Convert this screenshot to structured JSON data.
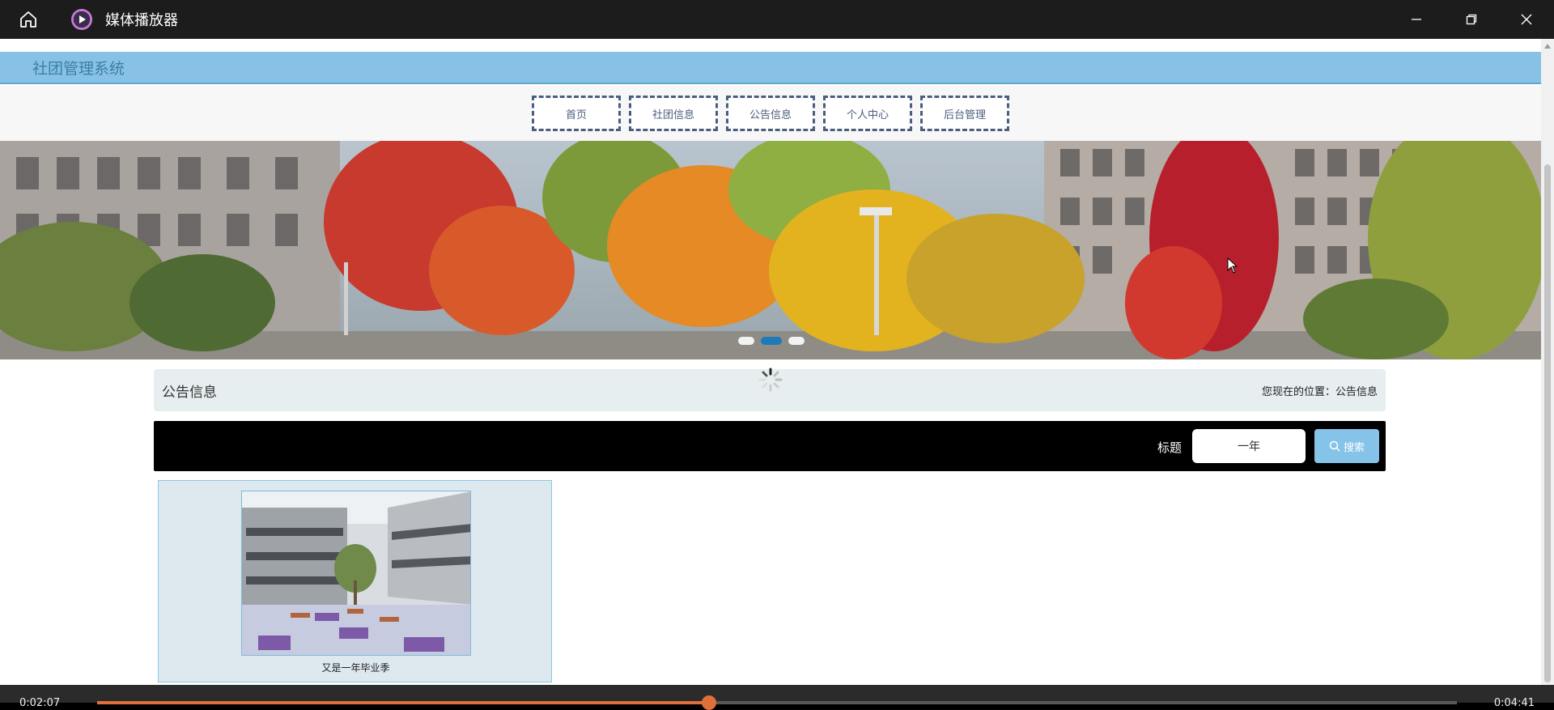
{
  "player": {
    "title": "媒体播放器",
    "time_current": "0:02:07",
    "time_total": "0:04:41",
    "progress": 0.45
  },
  "site": {
    "title": "社团管理系统",
    "nav": [
      "首页",
      "社团信息",
      "公告信息",
      "个人中心",
      "后台管理"
    ]
  },
  "section": {
    "title": "公告信息",
    "breadcrumb": "您现在的位置：公告信息"
  },
  "search": {
    "label": "标题",
    "value": "一年",
    "button": "搜索"
  },
  "cards": [
    {
      "caption": "又是一年毕业季"
    }
  ],
  "banner": {
    "dots": 3,
    "active_dot": 1
  },
  "colors": {
    "header_bg": "#87c2e6",
    "accent_blue": "#1e7ab8",
    "progress": "#e0703a"
  }
}
